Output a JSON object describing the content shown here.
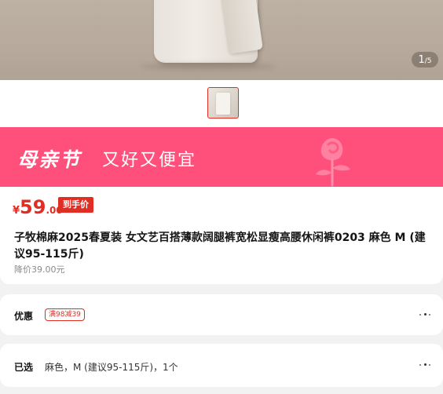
{
  "gallery": {
    "current_index": "1",
    "total": "/5"
  },
  "banner": {
    "title": "母亲节",
    "subtitle": "又好又便宜"
  },
  "product": {
    "price_currency": "¥",
    "price_integer": "59",
    "price_decimal": ".00",
    "price_tag": "到手价",
    "title": "子牧棉麻2025春夏装 女文艺百搭薄款阔腿裤宽松显瘦高腰休闲裤0203 麻色 M (建议95-115斤)",
    "reduced_price": "降价39.00元"
  },
  "promo": {
    "label": "优惠",
    "coupon": "满98减39"
  },
  "selection": {
    "label": "已选",
    "value": "麻色，M (建议95-115斤)，1个"
  },
  "colors": {
    "accent": "#e02e24",
    "banner": "#ff4f7b"
  }
}
